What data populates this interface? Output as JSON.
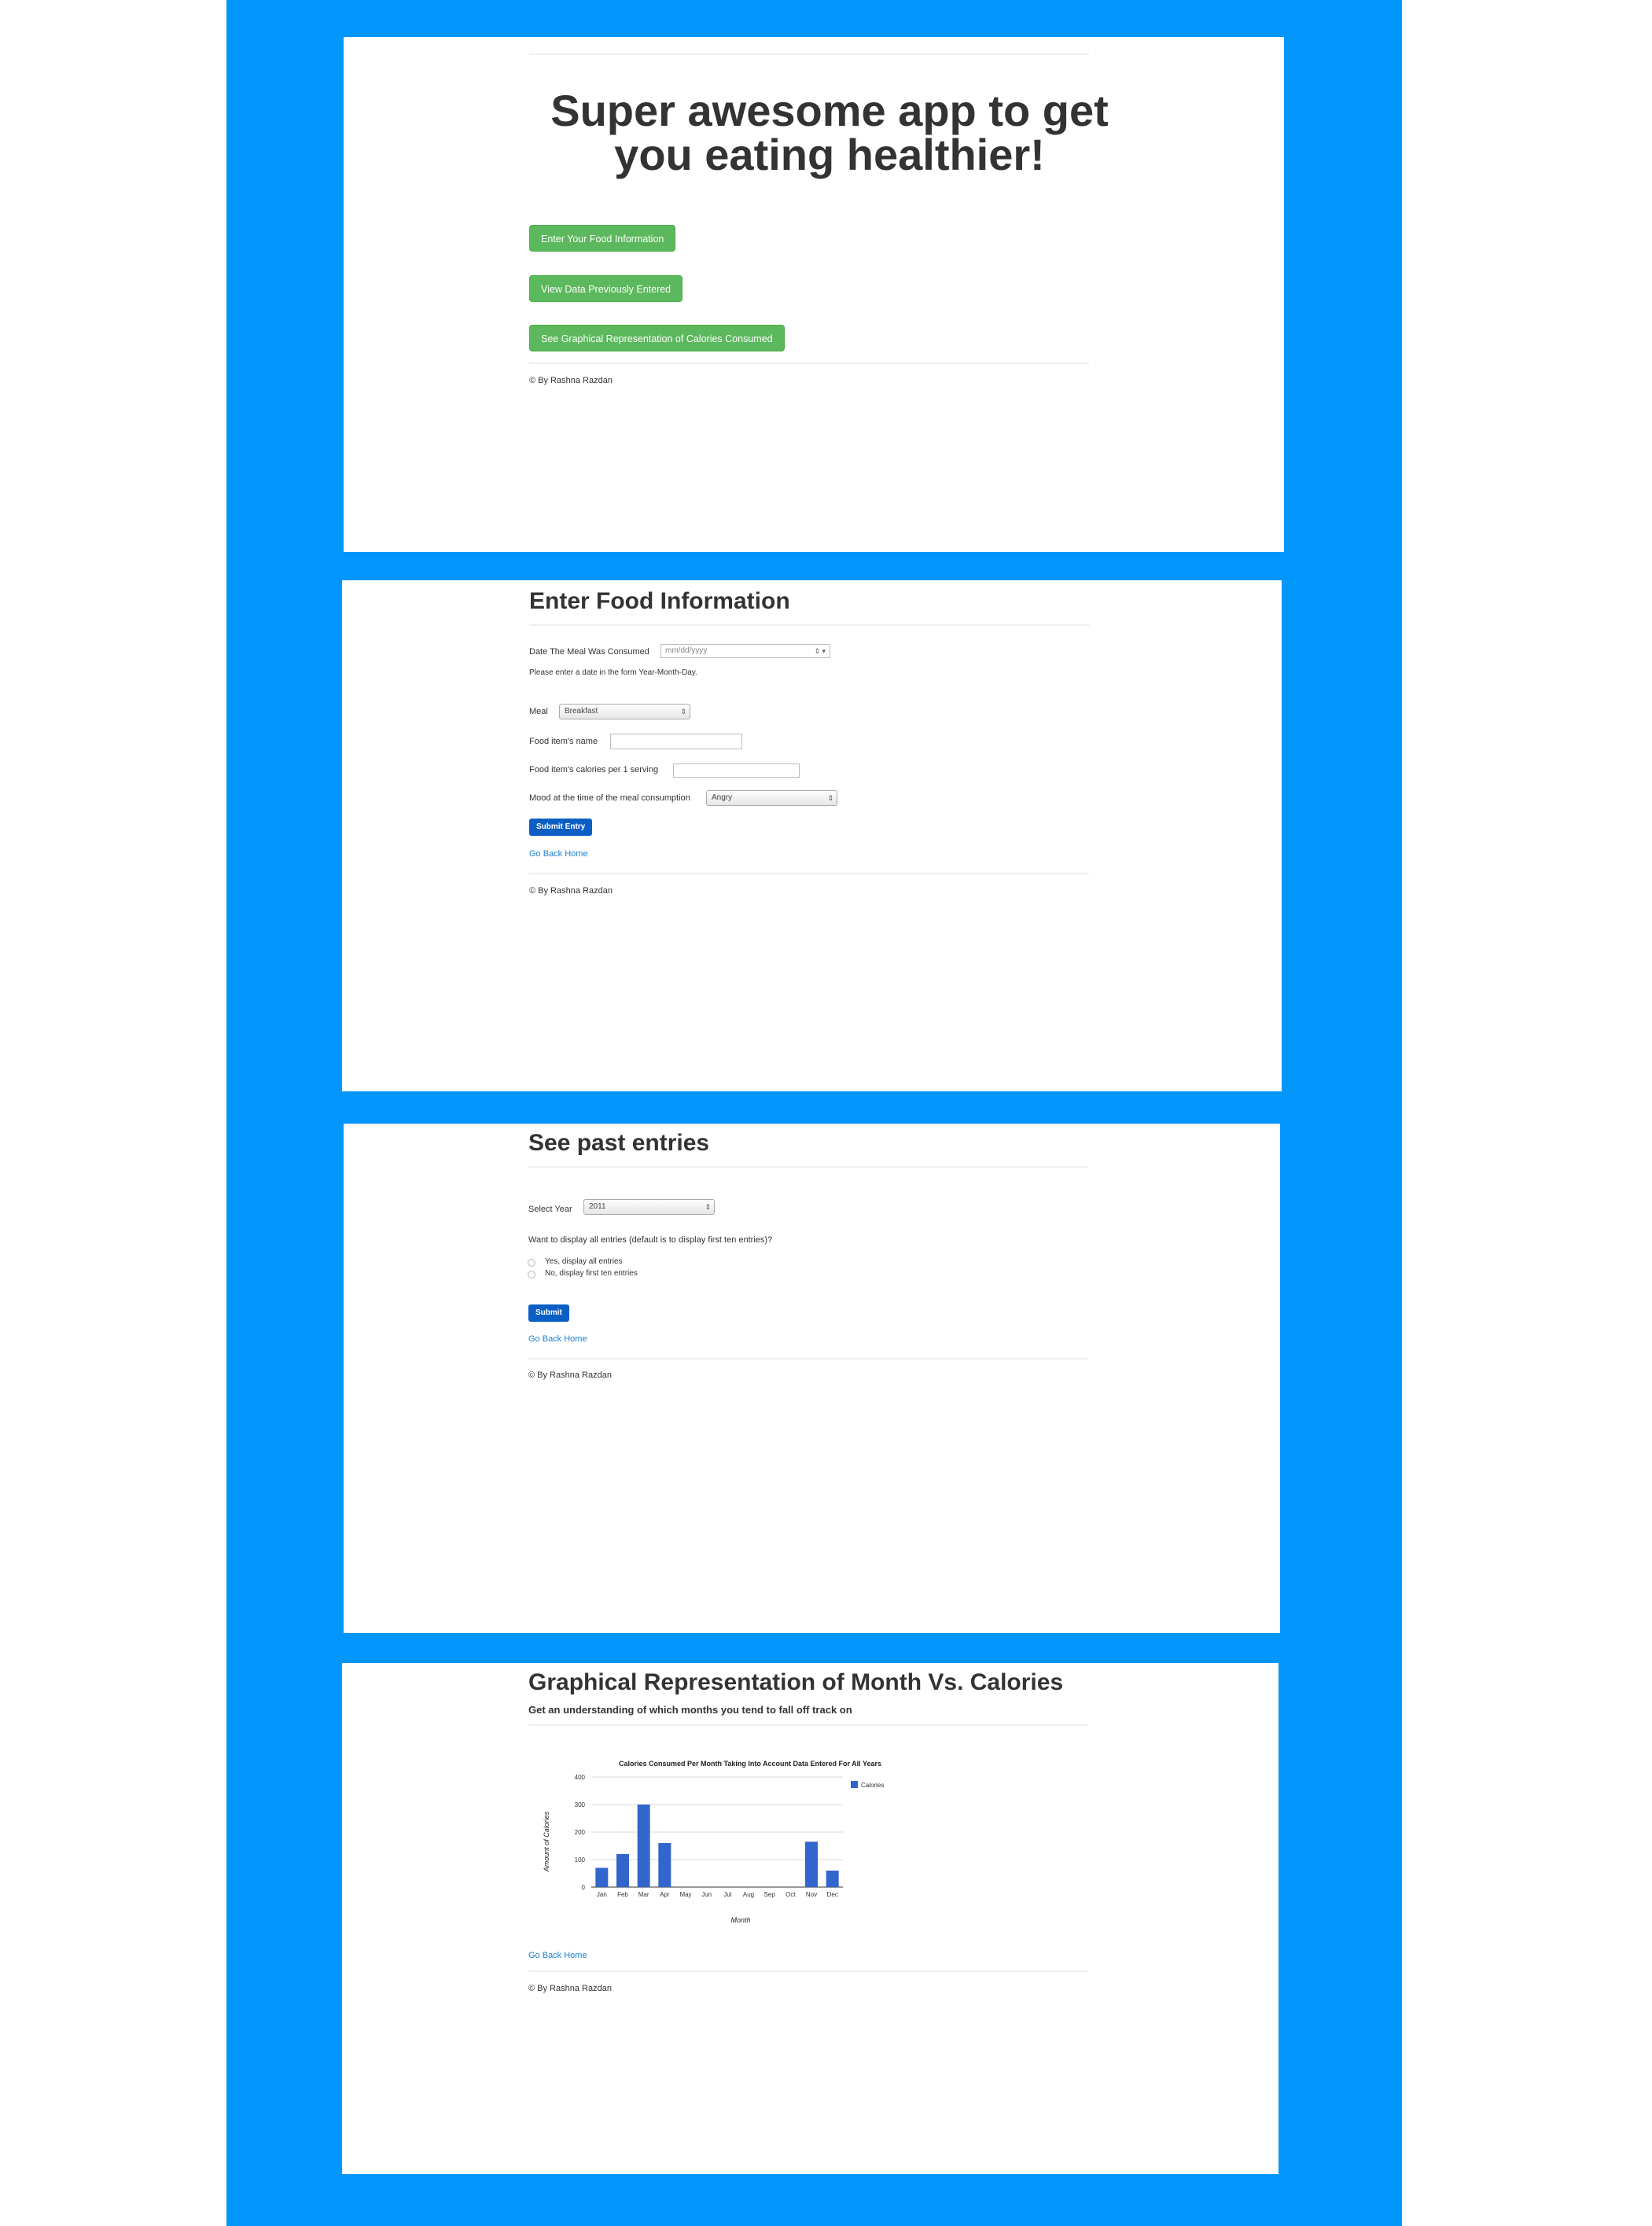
{
  "colors": {
    "backdrop": "#0096fc",
    "green_button": "#5cb85c",
    "blue_button": "#0b5fc4",
    "link": "#1a7fd0",
    "bar": "#3366cc"
  },
  "footer_text": "© By Rashna Razdan",
  "home": {
    "title": "Super awesome app to get you eating healthier!",
    "buttons": [
      "Enter Your Food Information",
      "View Data Previously Entered",
      "See Graphical Representation of Calories Consumed"
    ]
  },
  "enter_food": {
    "title": "Enter Food Information",
    "date_label": "Date The Meal Was Consumed",
    "date_placeholder": "mm/dd/yyyy",
    "date_help": "Please enter a date in the form Year-Month-Day.",
    "meal_label": "Meal",
    "meal_selected": "Breakfast",
    "food_name_label": "Food item's name",
    "food_name_value": "",
    "calories_label": "Food item's calories per 1 serving",
    "calories_value": "",
    "mood_label": "Mood at the time of the meal consumption",
    "mood_selected": "Angry",
    "submit_label": "Submit Entry",
    "back_link": "Go Back Home"
  },
  "past_entries": {
    "title": "See past entries",
    "year_label": "Select Year",
    "year_selected": "2011",
    "question": "Want to display all entries (default is to display first ten entries)?",
    "options": [
      "Yes, display all entries",
      "No, display first ten entries"
    ],
    "submit_label": "Submit",
    "back_link": "Go Back Home"
  },
  "graph_page": {
    "title": "Graphical Representation of Month Vs. Calories",
    "subtitle": "Get an understanding of which months you tend to fall off track on",
    "back_link": "Go Back Home"
  },
  "chart_data": {
    "type": "bar",
    "title": "Calories Consumed Per Month Taking Into Account Data Entered For All Years",
    "xlabel": "Month",
    "ylabel": "Amount of Calories",
    "categories": [
      "Jan",
      "Feb",
      "Mar",
      "Apr",
      "May",
      "Jun",
      "Jul",
      "Aug",
      "Sep",
      "Oct",
      "Nov",
      "Dec"
    ],
    "series": [
      {
        "name": "Calories",
        "values": [
          70,
          120,
          300,
          160,
          0,
          0,
          0,
          0,
          0,
          0,
          165,
          60
        ]
      }
    ],
    "yticks": [
      "0",
      "100",
      "200",
      "300",
      "400"
    ],
    "ylim": [
      0,
      400
    ],
    "legend_position": "right",
    "grid": true
  }
}
